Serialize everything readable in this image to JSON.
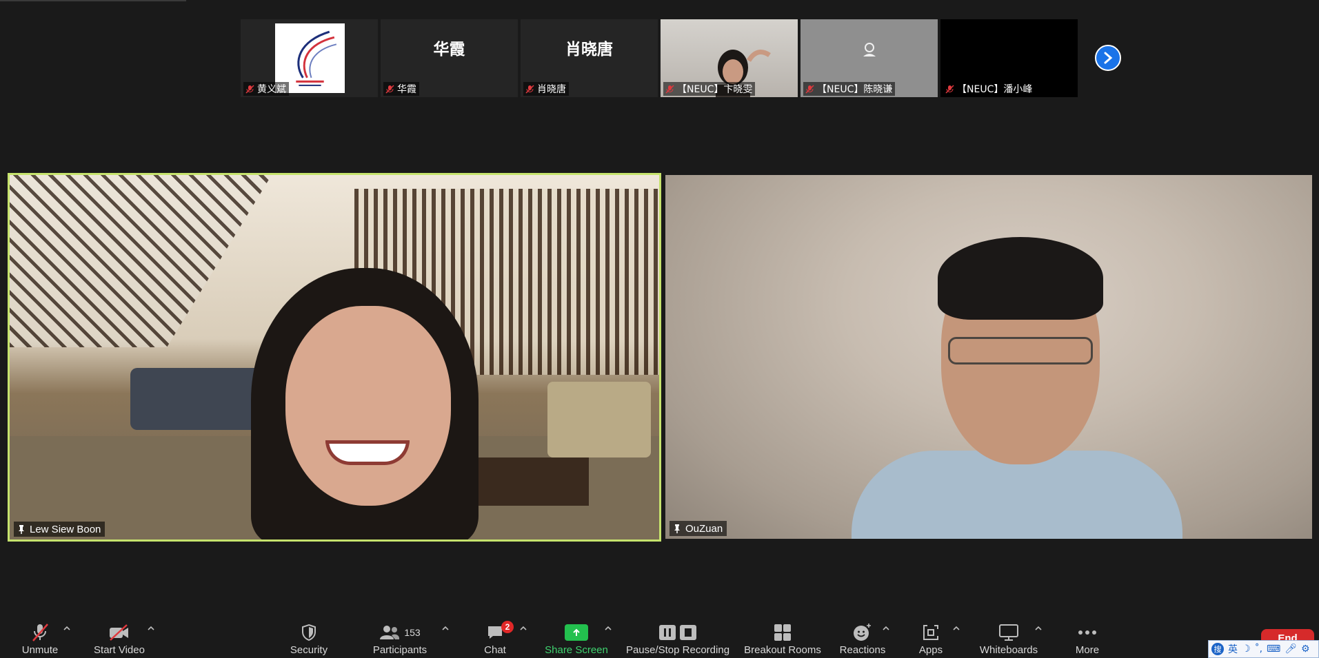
{
  "thumbnails": [
    {
      "name": "黄义斌",
      "type": "logo"
    },
    {
      "name": "华霞",
      "display": "华霞",
      "type": "text"
    },
    {
      "name": "肖晓唐",
      "display": "肖晓唐",
      "type": "text"
    },
    {
      "name": "【NEUC】卞晓雯",
      "type": "camera"
    },
    {
      "name": "【NEUC】陈晓谦",
      "type": "placeholder"
    },
    {
      "name": "【NEUC】潘小峰",
      "type": "black"
    }
  ],
  "main_videos": [
    {
      "name": "Lew Siew Boon",
      "active_speaker": true
    },
    {
      "name": "OuZuan",
      "active_speaker": false
    }
  ],
  "toolbar": {
    "unmute": "Unmute",
    "start_video": "Start Video",
    "security": "Security",
    "participants": "Participants",
    "participants_count": "153",
    "chat": "Chat",
    "chat_badge": "2",
    "share_screen": "Share Screen",
    "recording": "Pause/Stop Recording",
    "breakout_rooms": "Breakout Rooms",
    "reactions": "Reactions",
    "apps": "Apps",
    "whiteboards": "Whiteboards",
    "more": "More",
    "end": "End"
  },
  "ime": {
    "logo": "搜",
    "mode": "英"
  },
  "colors": {
    "active_speaker_border": "#c6e36d",
    "share_green": "#23c04e",
    "end_red": "#d62a2a",
    "muted_red": "#e0393e",
    "next_blue": "#1a73e8"
  }
}
